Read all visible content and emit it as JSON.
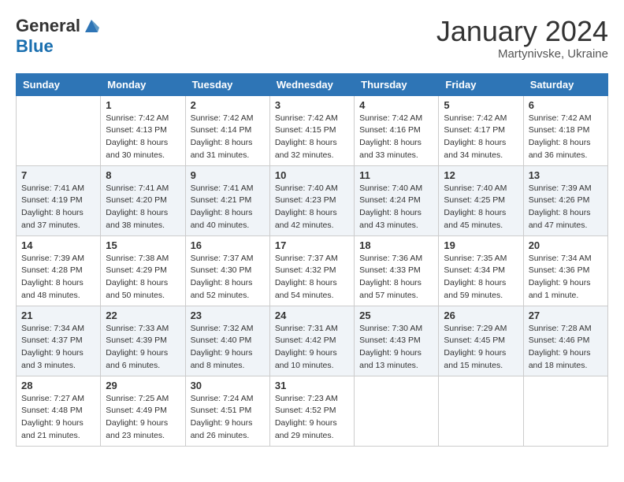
{
  "header": {
    "logo_general": "General",
    "logo_blue": "Blue",
    "month_title": "January 2024",
    "location": "Martynivske, Ukraine"
  },
  "weekdays": [
    "Sunday",
    "Monday",
    "Tuesday",
    "Wednesday",
    "Thursday",
    "Friday",
    "Saturday"
  ],
  "weeks": [
    [
      {
        "day": "",
        "sunrise": "",
        "sunset": "",
        "daylight": ""
      },
      {
        "day": "1",
        "sunrise": "Sunrise: 7:42 AM",
        "sunset": "Sunset: 4:13 PM",
        "daylight": "Daylight: 8 hours and 30 minutes."
      },
      {
        "day": "2",
        "sunrise": "Sunrise: 7:42 AM",
        "sunset": "Sunset: 4:14 PM",
        "daylight": "Daylight: 8 hours and 31 minutes."
      },
      {
        "day": "3",
        "sunrise": "Sunrise: 7:42 AM",
        "sunset": "Sunset: 4:15 PM",
        "daylight": "Daylight: 8 hours and 32 minutes."
      },
      {
        "day": "4",
        "sunrise": "Sunrise: 7:42 AM",
        "sunset": "Sunset: 4:16 PM",
        "daylight": "Daylight: 8 hours and 33 minutes."
      },
      {
        "day": "5",
        "sunrise": "Sunrise: 7:42 AM",
        "sunset": "Sunset: 4:17 PM",
        "daylight": "Daylight: 8 hours and 34 minutes."
      },
      {
        "day": "6",
        "sunrise": "Sunrise: 7:42 AM",
        "sunset": "Sunset: 4:18 PM",
        "daylight": "Daylight: 8 hours and 36 minutes."
      }
    ],
    [
      {
        "day": "7",
        "sunrise": "Sunrise: 7:41 AM",
        "sunset": "Sunset: 4:19 PM",
        "daylight": "Daylight: 8 hours and 37 minutes."
      },
      {
        "day": "8",
        "sunrise": "Sunrise: 7:41 AM",
        "sunset": "Sunset: 4:20 PM",
        "daylight": "Daylight: 8 hours and 38 minutes."
      },
      {
        "day": "9",
        "sunrise": "Sunrise: 7:41 AM",
        "sunset": "Sunset: 4:21 PM",
        "daylight": "Daylight: 8 hours and 40 minutes."
      },
      {
        "day": "10",
        "sunrise": "Sunrise: 7:40 AM",
        "sunset": "Sunset: 4:23 PM",
        "daylight": "Daylight: 8 hours and 42 minutes."
      },
      {
        "day": "11",
        "sunrise": "Sunrise: 7:40 AM",
        "sunset": "Sunset: 4:24 PM",
        "daylight": "Daylight: 8 hours and 43 minutes."
      },
      {
        "day": "12",
        "sunrise": "Sunrise: 7:40 AM",
        "sunset": "Sunset: 4:25 PM",
        "daylight": "Daylight: 8 hours and 45 minutes."
      },
      {
        "day": "13",
        "sunrise": "Sunrise: 7:39 AM",
        "sunset": "Sunset: 4:26 PM",
        "daylight": "Daylight: 8 hours and 47 minutes."
      }
    ],
    [
      {
        "day": "14",
        "sunrise": "Sunrise: 7:39 AM",
        "sunset": "Sunset: 4:28 PM",
        "daylight": "Daylight: 8 hours and 48 minutes."
      },
      {
        "day": "15",
        "sunrise": "Sunrise: 7:38 AM",
        "sunset": "Sunset: 4:29 PM",
        "daylight": "Daylight: 8 hours and 50 minutes."
      },
      {
        "day": "16",
        "sunrise": "Sunrise: 7:37 AM",
        "sunset": "Sunset: 4:30 PM",
        "daylight": "Daylight: 8 hours and 52 minutes."
      },
      {
        "day": "17",
        "sunrise": "Sunrise: 7:37 AM",
        "sunset": "Sunset: 4:32 PM",
        "daylight": "Daylight: 8 hours and 54 minutes."
      },
      {
        "day": "18",
        "sunrise": "Sunrise: 7:36 AM",
        "sunset": "Sunset: 4:33 PM",
        "daylight": "Daylight: 8 hours and 57 minutes."
      },
      {
        "day": "19",
        "sunrise": "Sunrise: 7:35 AM",
        "sunset": "Sunset: 4:34 PM",
        "daylight": "Daylight: 8 hours and 59 minutes."
      },
      {
        "day": "20",
        "sunrise": "Sunrise: 7:34 AM",
        "sunset": "Sunset: 4:36 PM",
        "daylight": "Daylight: 9 hours and 1 minute."
      }
    ],
    [
      {
        "day": "21",
        "sunrise": "Sunrise: 7:34 AM",
        "sunset": "Sunset: 4:37 PM",
        "daylight": "Daylight: 9 hours and 3 minutes."
      },
      {
        "day": "22",
        "sunrise": "Sunrise: 7:33 AM",
        "sunset": "Sunset: 4:39 PM",
        "daylight": "Daylight: 9 hours and 6 minutes."
      },
      {
        "day": "23",
        "sunrise": "Sunrise: 7:32 AM",
        "sunset": "Sunset: 4:40 PM",
        "daylight": "Daylight: 9 hours and 8 minutes."
      },
      {
        "day": "24",
        "sunrise": "Sunrise: 7:31 AM",
        "sunset": "Sunset: 4:42 PM",
        "daylight": "Daylight: 9 hours and 10 minutes."
      },
      {
        "day": "25",
        "sunrise": "Sunrise: 7:30 AM",
        "sunset": "Sunset: 4:43 PM",
        "daylight": "Daylight: 9 hours and 13 minutes."
      },
      {
        "day": "26",
        "sunrise": "Sunrise: 7:29 AM",
        "sunset": "Sunset: 4:45 PM",
        "daylight": "Daylight: 9 hours and 15 minutes."
      },
      {
        "day": "27",
        "sunrise": "Sunrise: 7:28 AM",
        "sunset": "Sunset: 4:46 PM",
        "daylight": "Daylight: 9 hours and 18 minutes."
      }
    ],
    [
      {
        "day": "28",
        "sunrise": "Sunrise: 7:27 AM",
        "sunset": "Sunset: 4:48 PM",
        "daylight": "Daylight: 9 hours and 21 minutes."
      },
      {
        "day": "29",
        "sunrise": "Sunrise: 7:25 AM",
        "sunset": "Sunset: 4:49 PM",
        "daylight": "Daylight: 9 hours and 23 minutes."
      },
      {
        "day": "30",
        "sunrise": "Sunrise: 7:24 AM",
        "sunset": "Sunset: 4:51 PM",
        "daylight": "Daylight: 9 hours and 26 minutes."
      },
      {
        "day": "31",
        "sunrise": "Sunrise: 7:23 AM",
        "sunset": "Sunset: 4:52 PM",
        "daylight": "Daylight: 9 hours and 29 minutes."
      },
      {
        "day": "",
        "sunrise": "",
        "sunset": "",
        "daylight": ""
      },
      {
        "day": "",
        "sunrise": "",
        "sunset": "",
        "daylight": ""
      },
      {
        "day": "",
        "sunrise": "",
        "sunset": "",
        "daylight": ""
      }
    ]
  ]
}
